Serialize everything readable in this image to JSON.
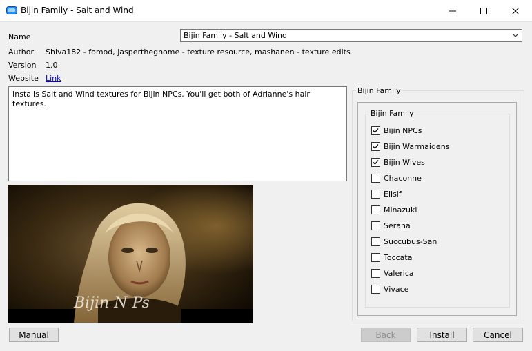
{
  "window": {
    "title": "Bijin Family - Salt and Wind"
  },
  "info": {
    "name_label": "Name",
    "name_value": "Bijin Family - Salt and Wind",
    "author_label": "Author",
    "author_value": "Shiva182 - fomod, jasperthegnome - texture resource, mashanen - texture edits",
    "version_label": "Version",
    "version_value": "1.0",
    "website_label": "Website",
    "website_link": "Link"
  },
  "description": "Installs Salt and Wind textures for Bijin NPCs. You'll get both of Adrianne's hair textures.",
  "group": {
    "outer_label": "Bijin Family",
    "inner_label": "Bijin Family",
    "options": [
      {
        "label": "Bijin NPCs",
        "checked": true
      },
      {
        "label": "Bijin Warmaidens",
        "checked": true
      },
      {
        "label": "Bijin Wives",
        "checked": true
      },
      {
        "label": "Chaconne",
        "checked": false
      },
      {
        "label": "Elisif",
        "checked": false
      },
      {
        "label": "Minazuki",
        "checked": false
      },
      {
        "label": "Serana",
        "checked": false
      },
      {
        "label": "Succubus-San",
        "checked": false
      },
      {
        "label": "Toccata",
        "checked": false
      },
      {
        "label": "Valerica",
        "checked": false
      },
      {
        "label": "Vivace",
        "checked": false
      }
    ]
  },
  "buttons": {
    "manual": "Manual",
    "back": "Back",
    "install": "Install",
    "cancel": "Cancel"
  },
  "preview": {
    "watermark": "Bijin N Ps"
  },
  "colors": {
    "link": "#0000ee",
    "accent": "#0078d7"
  }
}
